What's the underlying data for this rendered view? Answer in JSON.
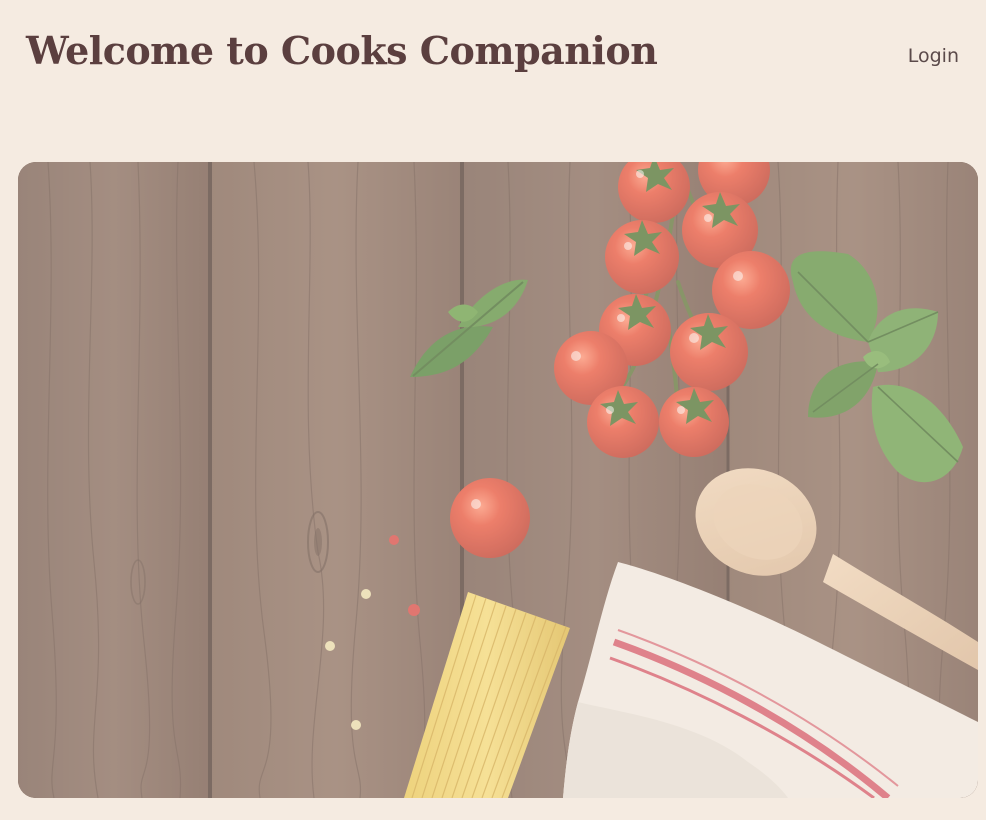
{
  "header": {
    "title": "Welcome to Cooks Companion",
    "login_label": "Login"
  },
  "hero": {
    "image": "hero-image",
    "items": [
      "tomatoes",
      "basil",
      "spaghetti",
      "wooden-spoon",
      "kitchen-towel",
      "peppercorns"
    ]
  },
  "colors": {
    "background": "#f5ebe1",
    "title": "#5b3f3f",
    "wood": "#6e5548",
    "tomato": "#e0402a",
    "basil": "#3f7d2c"
  }
}
